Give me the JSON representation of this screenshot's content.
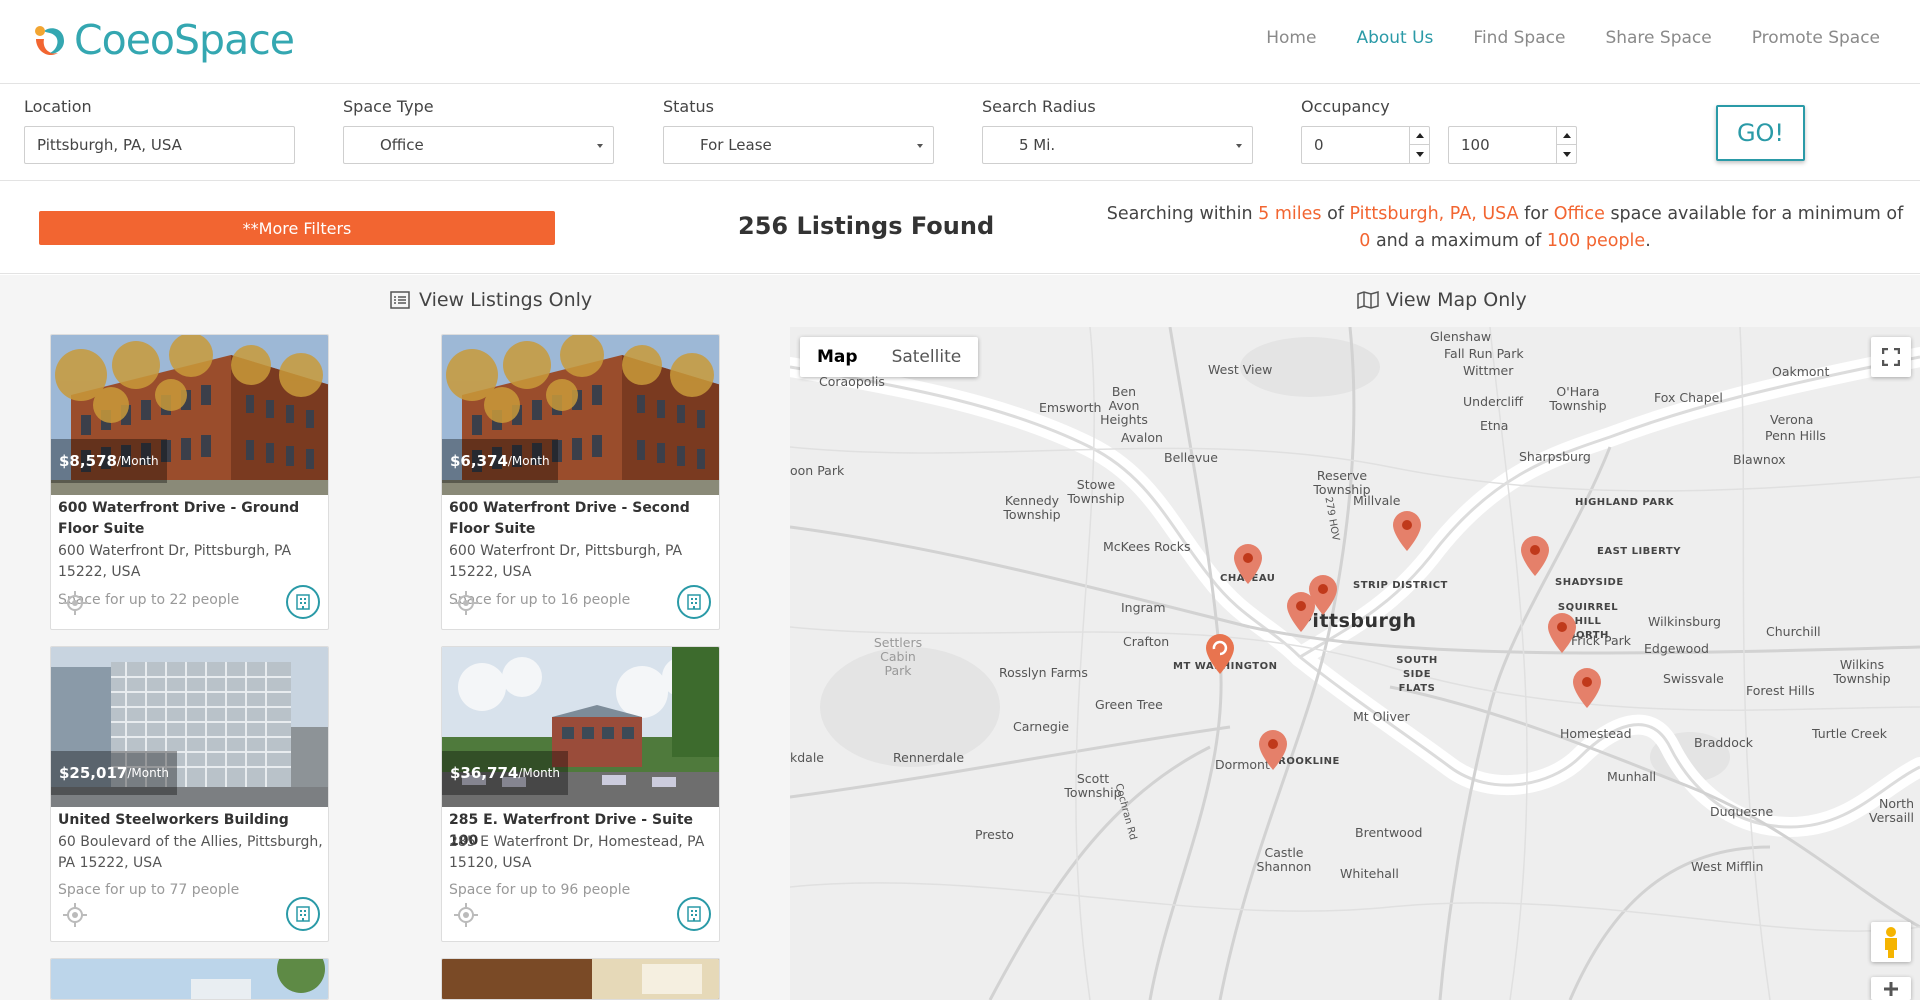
{
  "header": {
    "logo_text": "CoeoSpace",
    "nav": [
      "Home",
      "About Us",
      "Find Space",
      "Share Space",
      "Promote Space"
    ],
    "active_nav": "About Us"
  },
  "filters": {
    "location_label": "Location",
    "location_value": "Pittsburgh, PA, USA",
    "space_type_label": "Space Type",
    "space_type_value": "Office",
    "status_label": "Status",
    "status_value": "For Lease",
    "radius_label": "Search Radius",
    "radius_value": "5 Mi.",
    "occupancy_label": "Occupancy",
    "occupancy_min": "0",
    "occupancy_max": "100",
    "go_label": "GO!"
  },
  "summary": {
    "more_filters_label": "**More Filters",
    "listings_found": "256 Listings Found",
    "desc_1": "Searching within",
    "radius": "5 miles",
    "desc_2": "of",
    "location": "Pittsburgh, PA, USA",
    "desc_3": "for",
    "space_type": "Office",
    "desc_4": "space available for a minimum of",
    "min": "0",
    "desc_5": "and a maximum of",
    "max": "100 people",
    "desc_6": "."
  },
  "view_toggles": {
    "list_label": "View Listings Only",
    "map_label": "View Map Only"
  },
  "listings": [
    {
      "price": "$8,578",
      "per": "/Month",
      "title": "600 Waterfront Drive - Ground Floor Suite",
      "address": "600 Waterfront Dr, Pittsburgh, PA 15222, USA",
      "capacity": "Space for up to 22 people"
    },
    {
      "price": "$6,374",
      "per": "/Month",
      "title": "600 Waterfront Drive - Second Floor Suite",
      "address": "600 Waterfront Dr, Pittsburgh, PA 15222, USA",
      "capacity": "Space for up to 16 people"
    },
    {
      "price": "$25,017",
      "per": "/Month",
      "title": "United Steelworkers Building",
      "address": "60 Boulevard of the Allies, Pittsburgh, PA 15222, USA",
      "capacity": "Space for up to 77 people"
    },
    {
      "price": "$36,774",
      "per": "/Month",
      "title": "285 E. Waterfront Drive - Suite 100",
      "address": "285 E Waterfront Dr, Homestead, PA 15120, USA",
      "capacity": "Space for up to 96 people"
    }
  ],
  "map": {
    "tab_map": "Map",
    "tab_satellite": "Satellite",
    "labels": [
      "Glenshaw",
      "Fall Run Park",
      "West View",
      "Wittmer",
      "Oakmont",
      "Coraopolis",
      "Ben Avon Heights",
      "O'Hara Township",
      "Fox Chapel",
      "Emsworth",
      "Undercliff",
      "Verona",
      "Penn Hills",
      "Etna",
      "Avalon",
      "Sharpsburg",
      "Bellevue",
      "Blawnox",
      "oon Park",
      "Reserve Township",
      "Stowe Township",
      "Millvale",
      "Kennedy Township",
      "HIGHLAND PARK",
      "McKees Rocks",
      "EAST LIBERTY",
      "CHATEAU",
      "STRIP DISTRICT",
      "SHADYSIDE",
      "Ingram",
      "SQUIRREL HILL NORTH",
      "Pittsburgh",
      "Wilkinsburg",
      "Churchill",
      "Crafton",
      "Frick Park",
      "Settlers Cabin Park",
      "Edgewood",
      "MT WASHINGTON",
      "SOUTH SIDE FLATS",
      "Rosslyn Farms",
      "Wilkins Township",
      "Swissvale",
      "Forest Hills",
      "Green Tree",
      "Mt Oliver",
      "Carnegie",
      "Homestead",
      "Turtle Creek",
      "Braddock",
      "kdale",
      "Rennerdale",
      "Dormont",
      "BROOKLINE",
      "Munhall",
      "Scott Township",
      "Duquesne",
      "North Versaill",
      "Presto",
      "Brentwood",
      "Castle Shannon",
      "Whitehall",
      "West Mifflin",
      "279 HOV",
      "Cochran Rd"
    ]
  },
  "colors": {
    "brand_teal": "#2a9aa7",
    "accent_orange": "#f26531",
    "pin_color": "#e5806a"
  }
}
